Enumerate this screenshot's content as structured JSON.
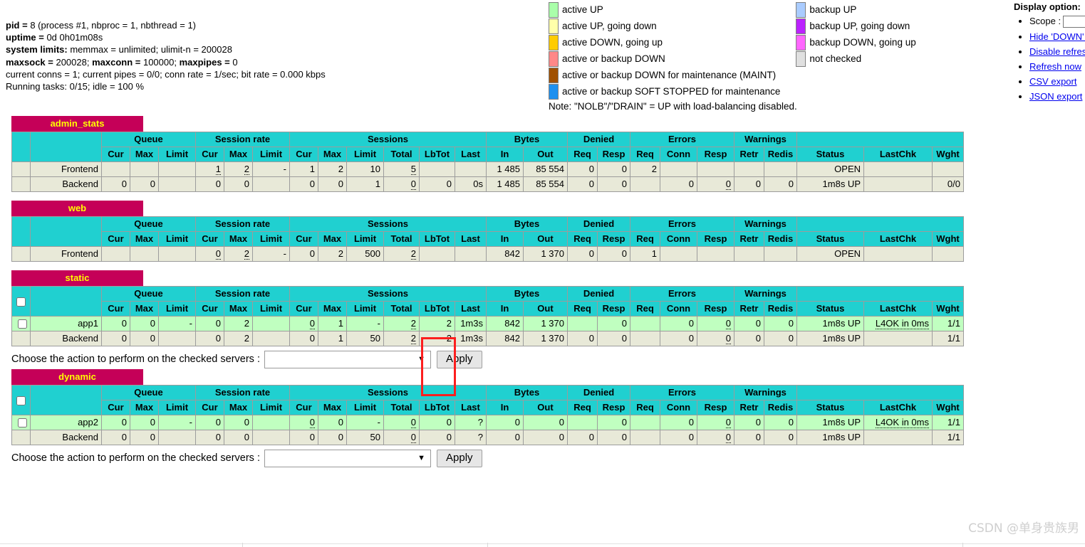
{
  "process_info": {
    "lines": [
      [
        {
          "t": "pid = ",
          "b": true
        },
        {
          "t": "8 (process #1, nbproc = 1, nbthread = 1)",
          "b": false
        }
      ],
      [
        {
          "t": "uptime = ",
          "b": true
        },
        {
          "t": "0d 0h01m08s",
          "b": false
        }
      ],
      [
        {
          "t": "system limits: ",
          "b": true
        },
        {
          "t": "memmax = unlimited; ulimit-n = 200028",
          "b": false
        }
      ],
      [
        {
          "t": "maxsock = ",
          "b": true
        },
        {
          "t": "200028; ",
          "b": false
        },
        {
          "t": "maxconn = ",
          "b": true
        },
        {
          "t": "100000; ",
          "b": false
        },
        {
          "t": "maxpipes = ",
          "b": true
        },
        {
          "t": "0",
          "b": false
        }
      ],
      [
        {
          "t": "current conns = 1; current pipes = 0/0; conn rate = 1/sec; bit rate = 0.000 kbps",
          "b": false
        }
      ],
      [
        {
          "t": "Running tasks: 0/15; idle = 100 %",
          "b": false
        }
      ]
    ]
  },
  "legend": {
    "left": [
      {
        "color": "#aaffaa",
        "label": "active UP"
      },
      {
        "color": "#ffffaa",
        "label": "active UP, going down"
      },
      {
        "color": "#ffcc00",
        "label": "active DOWN, going up"
      },
      {
        "color": "#ff8888",
        "label": "active or backup DOWN"
      },
      {
        "color": "#a05000",
        "label": "active or backup DOWN for maintenance (MAINT)"
      },
      {
        "color": "#1e90ef",
        "label": "active or backup SOFT STOPPED for maintenance"
      }
    ],
    "right": [
      {
        "color": "#aaccff",
        "label": "backup UP"
      },
      {
        "color": "#bb22ff",
        "label": "backup UP, going down"
      },
      {
        "color": "#ff66ff",
        "label": "backup DOWN, going up"
      },
      {
        "color": "#e0e0e0",
        "label": "not checked"
      }
    ],
    "note": "Note: \"NOLB\"/\"DRAIN\" = UP with load-balancing disabled."
  },
  "display_option": {
    "title": "Display option:",
    "scope_label": "Scope :",
    "scope_value": "",
    "links": [
      "Hide 'DOWN' servers",
      "Disable refresh",
      "Refresh now",
      "CSV export",
      "JSON export"
    ]
  },
  "columns": {
    "groups": [
      {
        "label": "Queue",
        "span": 3
      },
      {
        "label": "Session rate",
        "span": 3
      },
      {
        "label": "Sessions",
        "span": 6
      },
      {
        "label": "Bytes",
        "span": 2
      },
      {
        "label": "Denied",
        "span": 2
      },
      {
        "label": "Errors",
        "span": 3
      },
      {
        "label": "Warnings",
        "span": 2
      },
      {
        "label": "",
        "span": 3
      }
    ],
    "sub": [
      "Cur",
      "Max",
      "Limit",
      "Cur",
      "Max",
      "Limit",
      "Cur",
      "Max",
      "Limit",
      "Total",
      "LbTot",
      "Last",
      "In",
      "Out",
      "Req",
      "Resp",
      "Req",
      "Conn",
      "Resp",
      "Retr",
      "Redis",
      "Status",
      "LastChk",
      "Wght"
    ]
  },
  "proxies": [
    {
      "name": "admin_stats",
      "has_checkbox": false,
      "has_action_row": false,
      "rows": [
        {
          "kind": "frontend",
          "active": false,
          "name": "Frontend",
          "checkbox": false,
          "cells": [
            "",
            "",
            "",
            "1",
            "2",
            "-",
            "1",
            "2",
            "10",
            "5",
            "",
            "",
            "1 485",
            "85 554",
            "0",
            "0",
            "2",
            "",
            "",
            "",
            "",
            "OPEN",
            "",
            ""
          ],
          "dotted": [
            3,
            4,
            9
          ],
          "lastchk_link": false
        },
        {
          "kind": "backend",
          "active": false,
          "name": "Backend",
          "checkbox": false,
          "cells": [
            "0",
            "0",
            "",
            "0",
            "0",
            "",
            "0",
            "0",
            "1",
            "0",
            "0",
            "0s",
            "1 485",
            "85 554",
            "0",
            "0",
            "",
            "0",
            "0",
            "0",
            "0",
            "1m8s UP",
            "",
            "0/0"
          ],
          "dotted": [
            9,
            18
          ],
          "lastchk_link": false
        }
      ]
    },
    {
      "name": "web",
      "has_checkbox": false,
      "has_action_row": false,
      "rows": [
        {
          "kind": "frontend",
          "active": false,
          "name": "Frontend",
          "checkbox": false,
          "cells": [
            "",
            "",
            "",
            "0",
            "2",
            "-",
            "0",
            "2",
            "500",
            "2",
            "",
            "",
            "842",
            "1 370",
            "0",
            "0",
            "1",
            "",
            "",
            "",
            "",
            "OPEN",
            "",
            ""
          ],
          "dotted": [
            3,
            4,
            9
          ],
          "lastchk_link": false
        }
      ]
    },
    {
      "name": "static",
      "has_checkbox": true,
      "has_action_row": true,
      "rows": [
        {
          "kind": "server",
          "active": true,
          "name": "app1",
          "checkbox": true,
          "cells": [
            "0",
            "0",
            "-",
            "0",
            "2",
            "",
            "0",
            "1",
            "-",
            "2",
            "2",
            "1m3s",
            "842",
            "1 370",
            "",
            "0",
            "",
            "0",
            "0",
            "0",
            "0",
            "1m8s UP",
            "L4OK in 0ms",
            "1/1"
          ],
          "dotted": [
            6,
            9,
            18
          ],
          "lastchk_link": true
        },
        {
          "kind": "backend",
          "active": false,
          "name": "Backend",
          "checkbox": false,
          "cells": [
            "0",
            "0",
            "",
            "0",
            "2",
            "",
            "0",
            "1",
            "50",
            "2",
            "2",
            "1m3s",
            "842",
            "1 370",
            "0",
            "0",
            "",
            "0",
            "0",
            "0",
            "0",
            "1m8s UP",
            "",
            "1/1"
          ],
          "dotted": [
            9,
            18
          ],
          "lastchk_link": false
        }
      ]
    },
    {
      "name": "dynamic",
      "has_checkbox": true,
      "has_action_row": true,
      "rows": [
        {
          "kind": "server",
          "active": true,
          "name": "app2",
          "checkbox": true,
          "cells": [
            "0",
            "0",
            "-",
            "0",
            "0",
            "",
            "0",
            "0",
            "-",
            "0",
            "0",
            "?",
            "0",
            "0",
            "",
            "0",
            "",
            "0",
            "0",
            "0",
            "0",
            "1m8s UP",
            "L4OK in 0ms",
            "1/1"
          ],
          "dotted": [
            6,
            9,
            18
          ],
          "lastchk_link": true
        },
        {
          "kind": "backend",
          "active": false,
          "name": "Backend",
          "checkbox": false,
          "cells": [
            "0",
            "0",
            "",
            "0",
            "0",
            "",
            "0",
            "0",
            "50",
            "0",
            "0",
            "?",
            "0",
            "0",
            "0",
            "0",
            "",
            "0",
            "0",
            "0",
            "0",
            "1m8s UP",
            "",
            "1/1"
          ],
          "dotted": [
            9,
            18
          ],
          "lastchk_link": false
        }
      ]
    }
  ],
  "action_row": {
    "label": "Choose the action to perform on the checked servers :",
    "select_value": "",
    "apply_label": "Apply"
  },
  "watermark": "CSDN @单身贵族男",
  "colors": {
    "header_bg": "#20d0d0",
    "title_bg": "#c50058",
    "title_fg": "#ffff00",
    "row_even": "#e8e9d8",
    "row_active": "#c0ffc0",
    "highlight_border": "#fc1e1e",
    "link": "#0000ee"
  }
}
